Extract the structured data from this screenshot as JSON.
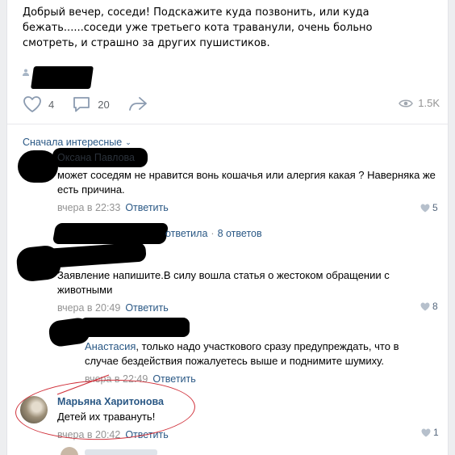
{
  "post": {
    "text": "Добрый вечер, соседи! Подскажите куда позвонить, или куда бежать......соседи уже третьего кота траванули, очень больно смотреть, и страшно за других пушистиков.",
    "likes": "4",
    "comments": "20",
    "views": "1.5K"
  },
  "sort_label": "Сначала интересные",
  "comments": [
    {
      "name": "Оксана Павлова",
      "text": "может соседям не нравится вонь кошачья или алергия какая ? Наверняка же есть причина.",
      "time": "вчера в 22:33",
      "reply": "Ответить",
      "likes": "5"
    },
    {
      "thread_answered": "ответила",
      "thread_count": "8 ответов"
    },
    {
      "text": "Заявление напишите.В силу вошла статья о жестоком обращении с животными",
      "time": "вчера в 20:49",
      "reply": "Ответить",
      "likes": "8"
    },
    {
      "mention": "Анастасия",
      "text": ", только надо участкового сразу предупреждать, что в случае бездействия пожалуетесь выше и поднимите шумиху.",
      "time": "вчера в 22:49",
      "reply": "Ответить"
    },
    {
      "name": "Марьяна Харитонова",
      "text": "Детей их травануть!",
      "time": "вчера в 20:42",
      "reply": "Ответить",
      "likes": "1"
    }
  ],
  "colors": {
    "link": "#2a5885",
    "meta": "#939393",
    "annotation": "#d0303a"
  }
}
